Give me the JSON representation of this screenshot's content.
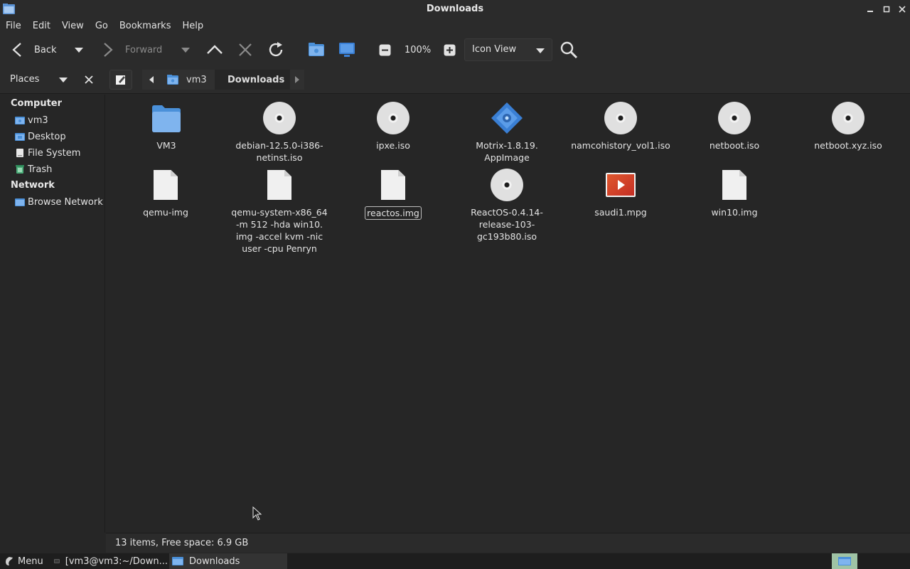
{
  "window": {
    "title": "Downloads",
    "minimize": "_",
    "maximize": "□",
    "close": "✕"
  },
  "menu": [
    "File",
    "Edit",
    "View",
    "Go",
    "Bookmarks",
    "Help"
  ],
  "toolbar": {
    "back_label": "Back",
    "forward_label": "Forward",
    "zoom_level": "100%",
    "view_mode": "Icon View"
  },
  "location": {
    "places_label": "Places",
    "crumbs": [
      "vm3",
      "Downloads"
    ]
  },
  "sidebar": {
    "sections": [
      {
        "heading": "Computer",
        "items": [
          "vm3",
          "Desktop",
          "File System",
          "Trash"
        ]
      },
      {
        "heading": "Network",
        "items": [
          "Browse Network"
        ]
      }
    ]
  },
  "files": [
    {
      "name": "VM3",
      "kind": "folder"
    },
    {
      "name": "debian-12.5.0-i386-netinst.iso",
      "kind": "disc"
    },
    {
      "name": "ipxe.iso",
      "kind": "disc"
    },
    {
      "name": "Motrix-1.8.19.AppImage",
      "kind": "appimage"
    },
    {
      "name": "namcohistory_vol1.iso",
      "kind": "disc"
    },
    {
      "name": "netboot.iso",
      "kind": "disc"
    },
    {
      "name": "netboot.xyz.iso",
      "kind": "disc"
    },
    {
      "name": "qemu-img",
      "kind": "doc"
    },
    {
      "name": "qemu-system-x86_64 -m 512 -hda win10.img -accel kvm -nic user -cpu Penryn",
      "kind": "doc"
    },
    {
      "name": "reactos.img",
      "kind": "doc",
      "selected": true
    },
    {
      "name": "ReactOS-0.4.14-release-103-gc193b80.iso",
      "kind": "disc"
    },
    {
      "name": "saudi1.mpg",
      "kind": "video"
    },
    {
      "name": "win10.img",
      "kind": "doc"
    }
  ],
  "file_name_lines": {
    "debian": [
      "debian-12.5.0-i386-",
      "netinst.iso"
    ],
    "motrix": [
      "Motrix-1.8.19.",
      "AppImage"
    ],
    "qemu_sys": [
      "qemu-system-x86_64",
      "-m 512 -hda win10.",
      "img -accel kvm -nic",
      "user -cpu Penryn"
    ],
    "reactos_iso": [
      "ReactOS-0.4.14-",
      "release-103-",
      "gc193b80.iso"
    ]
  },
  "status": {
    "text": "13 items, Free space: 6.9 GB"
  },
  "taskbar": {
    "menu_label": "Menu",
    "tasks": [
      "[vm3@vm3:~/Down...",
      "Downloads"
    ]
  },
  "colors": {
    "accent": "#4a90d9",
    "folder": "#6aa8e8",
    "video": "#d9452b"
  }
}
